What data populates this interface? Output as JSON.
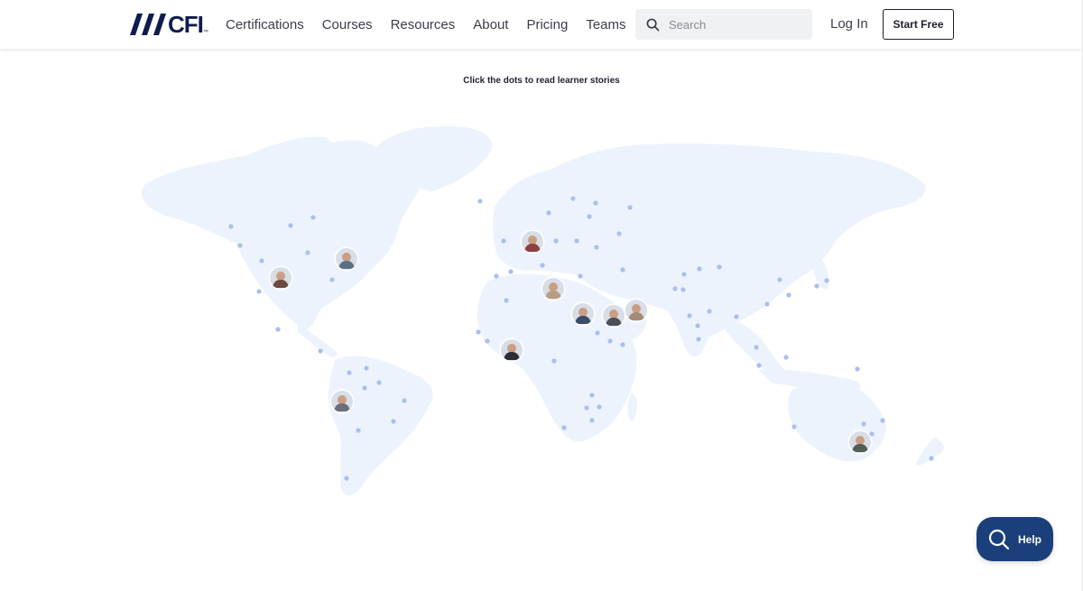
{
  "header": {
    "logo_text": "CFI",
    "logo_tm": "™",
    "nav": [
      "Certifications",
      "Courses",
      "Resources",
      "About",
      "Pricing",
      "Teams"
    ],
    "search_placeholder": "Search",
    "login_label": "Log In",
    "start_label": "Start Free"
  },
  "main": {
    "hint": "Click the dots to read learner stories"
  },
  "help": {
    "label": "Help"
  },
  "colors": {
    "brand": "#0f1c4d",
    "land": "#edf3fc",
    "dot": "#a9bfee",
    "help_bg": "#1a3f7a"
  },
  "icons": [
    "logo-mark-icon",
    "search-icon",
    "help-search-icon"
  ]
}
